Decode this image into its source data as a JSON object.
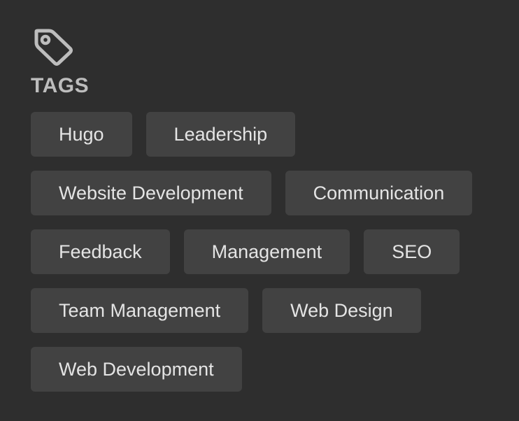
{
  "widget": {
    "icon": "tag-icon",
    "heading": "TAGS",
    "colors": {
      "background": "#2e2e2e",
      "chip_background": "#424242",
      "chip_text": "#e4e4e4",
      "heading_text": "#bdbdbd"
    }
  },
  "tags": [
    {
      "label": "Hugo"
    },
    {
      "label": "Leadership"
    },
    {
      "label": "Website Development"
    },
    {
      "label": "Communication"
    },
    {
      "label": "Feedback"
    },
    {
      "label": "Management"
    },
    {
      "label": "SEO"
    },
    {
      "label": "Team Management"
    },
    {
      "label": "Web Design"
    },
    {
      "label": "Web Development"
    }
  ]
}
